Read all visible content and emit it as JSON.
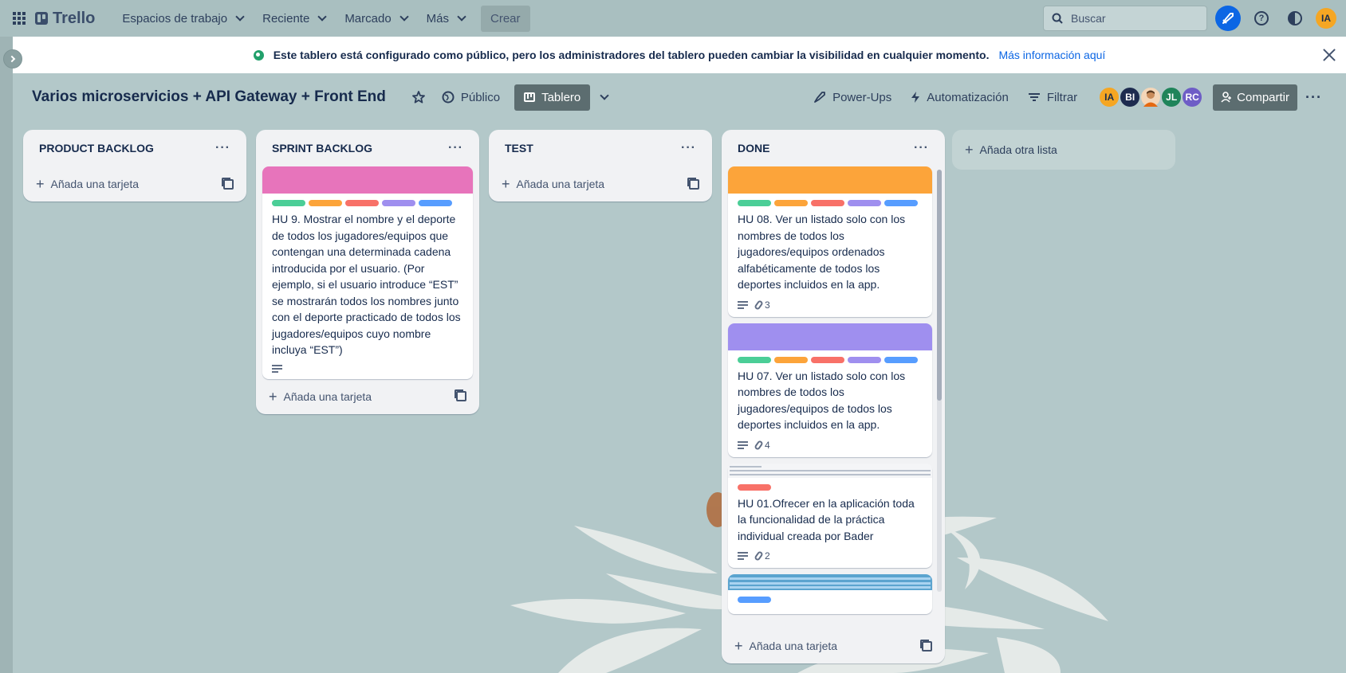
{
  "topnav": {
    "brand": "Trello",
    "menu": [
      {
        "label": "Espacios de trabajo"
      },
      {
        "label": "Reciente"
      },
      {
        "label": "Marcado"
      },
      {
        "label": "Más"
      }
    ],
    "create_label": "Crear",
    "search_placeholder": "Buscar",
    "user_initials": "IA"
  },
  "banner": {
    "message": "Este tablero está configurado como público, pero los administradores del tablero pueden cambiar la visibilidad en cualquier momento.",
    "link": "Más información aquí"
  },
  "board": {
    "title": "Varios microservicios + API Gateway + Front End",
    "visibility": "Público",
    "view": "Tablero",
    "powerups": "Power-Ups",
    "automation": "Automatización",
    "filter": "Filtrar",
    "share": "Compartir",
    "members": [
      {
        "initials": "IA",
        "color": "#f5a623"
      },
      {
        "initials": "BI",
        "color": "#1d2b4f"
      },
      {
        "initials": "",
        "color": "#e56910"
      },
      {
        "initials": "JL",
        "color": "#1f845a"
      },
      {
        "initials": "RC",
        "color": "#6e5dc6"
      }
    ]
  },
  "lists": [
    {
      "title": "PRODUCT BACKLOG",
      "add_card": "Añada una tarjeta",
      "cards": []
    },
    {
      "title": "SPRINT BACKLOG",
      "add_card": "Añada una tarjeta",
      "cards": [
        {
          "cover": "#e774bb",
          "labels": [
            "#4bce97",
            "#fca43a",
            "#f87168",
            "#9f8fef",
            "#579dff"
          ],
          "title": "HU 9. Mostrar el nombre y el deporte de todos los jugadores/equipos que contengan una determinada cadena introducida por el usuario. (Por ejemplo, si el usuario introduce “EST” se mostrarán todos los nombres junto con el deporte practicado de todos los jugadores/equipos cuyo nombre incluya “EST”)",
          "has_description": true,
          "attachments": ""
        }
      ]
    },
    {
      "title": "TEST",
      "add_card": "Añada una tarjeta",
      "cards": []
    },
    {
      "title": "DONE",
      "add_card": "Añada una tarjeta",
      "cards": [
        {
          "cover": "#fca43a",
          "labels": [
            "#4bce97",
            "#fca43a",
            "#f87168",
            "#9f8fef",
            "#579dff"
          ],
          "title": "HU 08. Ver un listado solo con los nombres de todos los jugadores/equipos ordenados alfabéticamente de todos los deportes incluidos en la app.",
          "has_description": true,
          "attachments": "3"
        },
        {
          "cover": "#9f8fef",
          "labels": [
            "#4bce97",
            "#fca43a",
            "#f87168",
            "#9f8fef",
            "#579dff"
          ],
          "title": "HU 07. Ver un listado solo con los nombres de todos los jugadores/equipos de todos los deportes incluidos en la app.",
          "has_description": true,
          "attachments": "4"
        },
        {
          "cover": "thumbnail",
          "labels": [
            "#f87168"
          ],
          "title": "HU 01.Ofrecer en la aplicación toda la funcionalidad de la práctica individual creada por Bader",
          "has_description": true,
          "attachments": "2"
        },
        {
          "cover": "thumbnail2",
          "labels": [
            "#579dff"
          ],
          "title": "",
          "has_description": false,
          "attachments": ""
        }
      ]
    }
  ],
  "add_list": "Añada otra lista"
}
